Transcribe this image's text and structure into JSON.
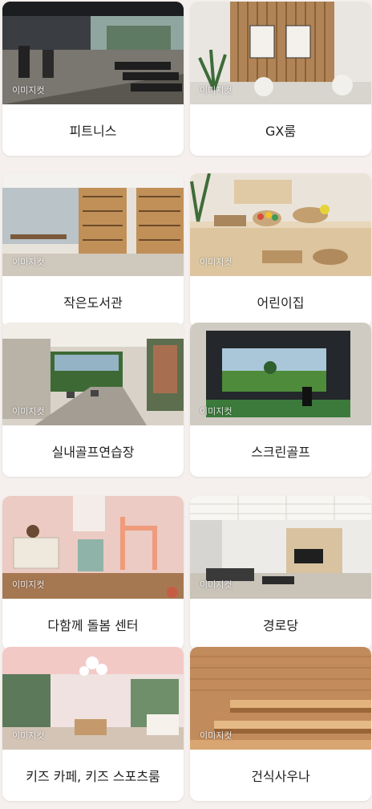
{
  "watermark": "이미지컷",
  "facilities": [
    {
      "label": "피트니스"
    },
    {
      "label": "GX룸"
    },
    {
      "label": "작은도서관"
    },
    {
      "label": "어린이집"
    },
    {
      "label": "실내골프연습장"
    },
    {
      "label": "스크린골프"
    },
    {
      "label": "다함께 돌봄 센터"
    },
    {
      "label": "경로당"
    },
    {
      "label": "키즈 카페, 키즈 스포츠룸"
    },
    {
      "label": "건식사우나"
    }
  ]
}
